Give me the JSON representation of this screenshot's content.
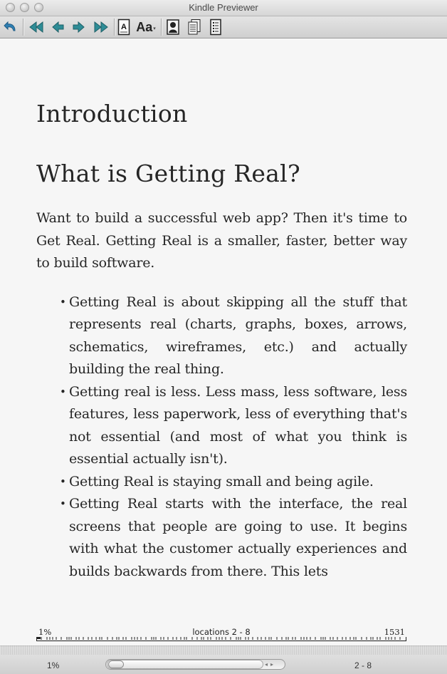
{
  "window": {
    "title": "Kindle Previewer"
  },
  "toolbar": {
    "buttons": [
      {
        "name": "back-icon",
        "label": "Back"
      },
      {
        "name": "first-page-icon",
        "label": "First"
      },
      {
        "name": "previous-page-icon",
        "label": "Previous"
      },
      {
        "name": "next-page-icon",
        "label": "Next"
      },
      {
        "name": "last-page-icon",
        "label": "Last"
      },
      {
        "name": "text-view-icon",
        "label": "Text"
      },
      {
        "name": "font-size-icon",
        "label": "Aa"
      },
      {
        "name": "portrait-icon",
        "label": "Cover"
      },
      {
        "name": "pages-icon",
        "label": "Pages"
      },
      {
        "name": "toc-icon",
        "label": "TOC"
      }
    ],
    "font_label": "Aa"
  },
  "book": {
    "chapter_title": "Introduction",
    "section_title": "What is Getting Real?",
    "intro_paragraph": "Want to build a successful web app? Then it's time to Get Real. Getting Real is a smaller, faster, better way to build software.",
    "bullets": [
      "Getting Real is about skipping all the stuff that represents real (charts, graphs, boxes, arrows, schematics, wireframes, etc.) and actually building the real thing.",
      "Getting real is less. Less mass, less software, less features, less paperwork, less of everything that's not essential (and most of what you think is essential actually isn't).",
      "Getting Real is staying small and being agile.",
      "Getting Real starts with the interface, the real screens that people are going to use. It begins with what the customer actually experiences and builds backwards from there. This lets"
    ],
    "bullet_glyph": "•"
  },
  "location_bar": {
    "percent": "1%",
    "locations": "locations 2 - 8",
    "total": "1531",
    "progress_fraction": 0.01
  },
  "status_bar": {
    "percent": "1%",
    "range": "2 - 8"
  },
  "colors": {
    "toolbar_icon_teal": "#2e8c96",
    "text": "#262626",
    "page_bg": "#f6f6f6"
  }
}
